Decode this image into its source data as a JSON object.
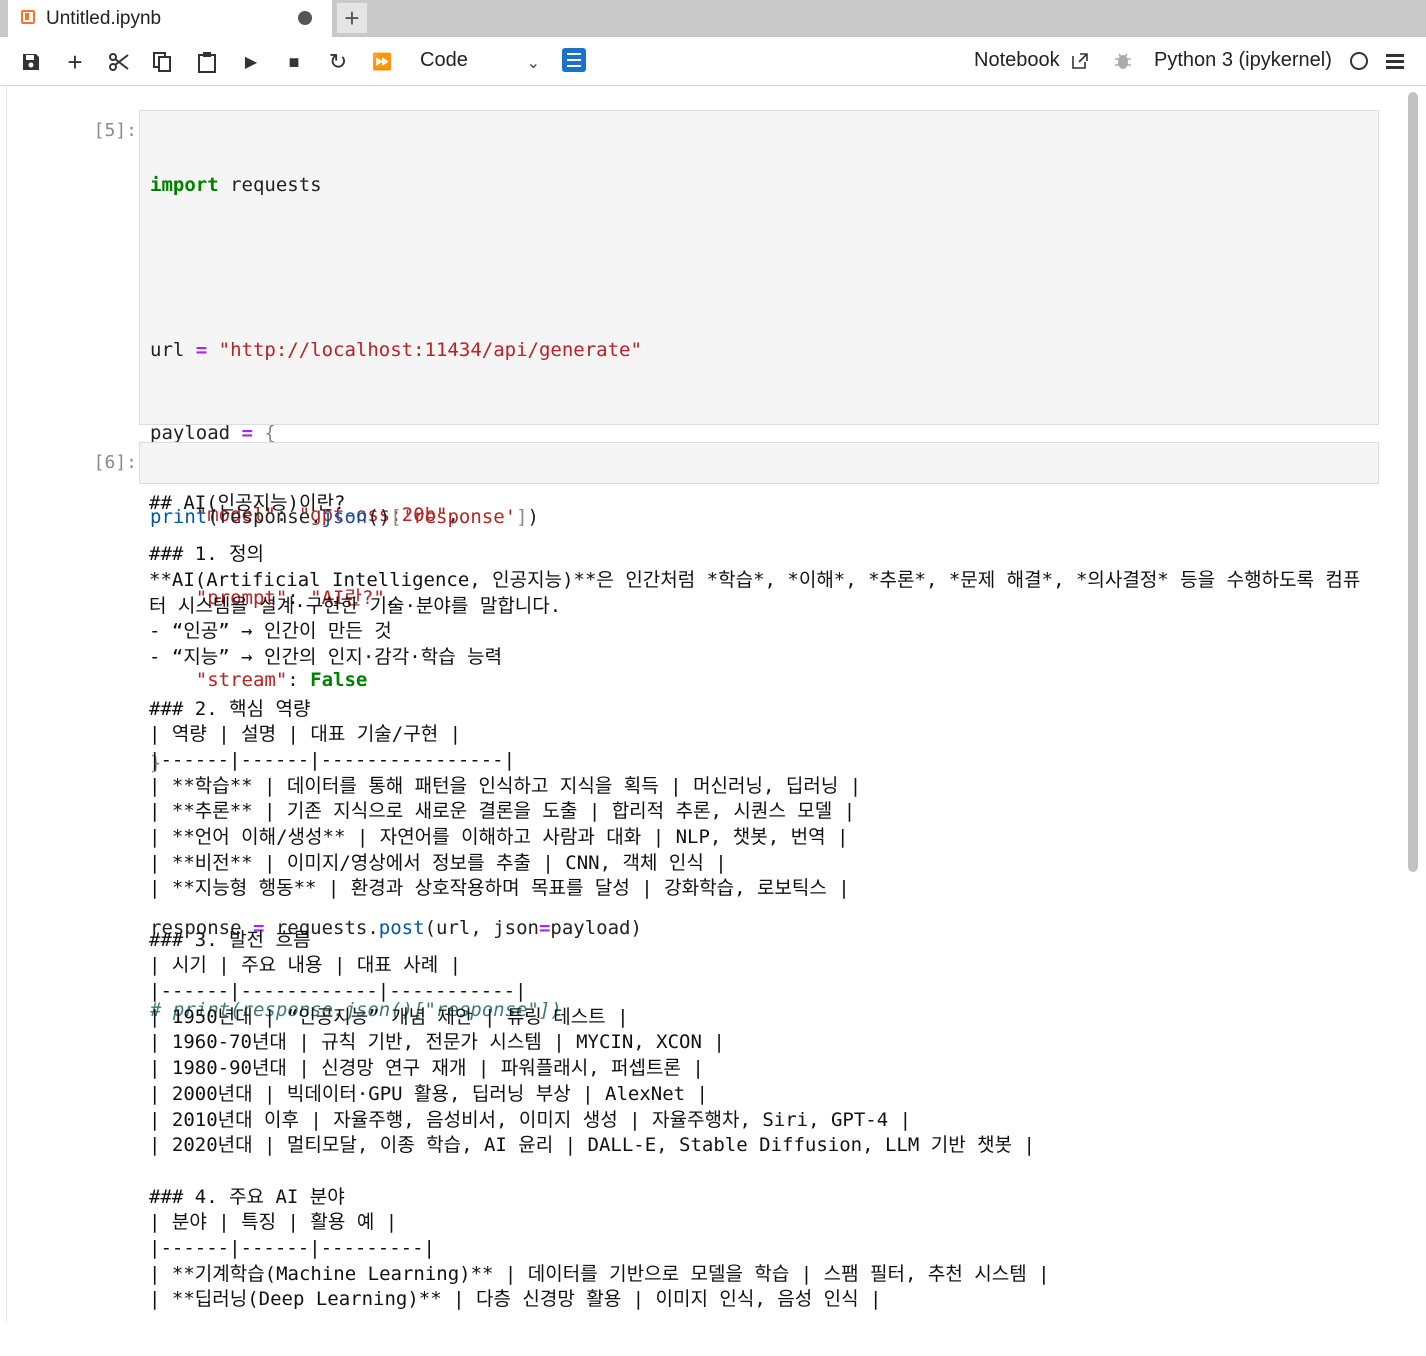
{
  "tab": {
    "title": "Untitled.ipynb",
    "new_tab": "+"
  },
  "toolbar": {
    "save": "save-icon",
    "add": "+",
    "cut": "cut-icon",
    "copy": "copy-icon",
    "paste": "paste-icon",
    "run": "▶",
    "stop": "■",
    "restart": "↻",
    "run_all": "⏩",
    "cell_type": "Code",
    "notebook_link": "Notebook",
    "kernel": "Python 3 (ipykernel)"
  },
  "cells": [
    {
      "prompt": "[5]:",
      "code": {
        "l1_kw": "import",
        "l1_rest": " requests",
        "l3_a": "url ",
        "l3_op": "=",
        "l3_str": " \"http://localhost:11434/api/generate\"",
        "l4_a": "payload ",
        "l4_op": "=",
        "l4_br": " {",
        "l5_k": "    \"model\"",
        "l5_sep": ": ",
        "l5_v": "\"gpt-oss:20b\"",
        "l5_end": ",",
        "l6_k": "    \"prompt\"",
        "l6_sep": ": ",
        "l6_v": "\"AI란?\"",
        "l6_end": ",",
        "l7_k": "    \"stream\"",
        "l7_sep": ": ",
        "l7_v": "False",
        "l8_br": "}",
        "l10_a": "response ",
        "l10_op": "=",
        "l10_b": " requests.",
        "l10_fn": "post",
        "l10_c": "(url, json",
        "l10_op2": "=",
        "l10_d": "payload)",
        "l11_cm": "# print(response.json()[\"response\"])"
      }
    },
    {
      "prompt": "[6]:",
      "code": {
        "fn1": "print",
        "a": "(response.",
        "fn2": "json",
        "b": "()",
        "br1": "[",
        "str": "'response'",
        "br2": "]",
        "c": ")"
      }
    }
  ],
  "output_lines": [
    "## AI(인공지능)이란?",
    "",
    "### 1. 정의",
    "**AI(Artificial Intelligence, 인공지능)**은 인간처럼 *학습*, *이해*, *추론*, *문제 해결*, *의사결정* 등을 수행하도록 컴퓨",
    "터 시스템을 설계·구현한 기술·분야를 말합니다.",
    "- “인공” → 인간이 만든 것",
    "- “지능” → 인간의 인지·감각·학습 능력",
    "",
    "### 2. 핵심 역량",
    "| 역량 | 설명 | 대표 기술/구현 |",
    "|------|------|----------------|",
    "| **학습** | 데이터를 통해 패턴을 인식하고 지식을 획득 | 머신러닝, 딥러닝 |",
    "| **추론** | 기존 지식으로 새로운 결론을 도출 | 합리적 추론, 시퀀스 모델 |",
    "| **언어 이해/생성** | 자연어를 이해하고 사람과 대화 | NLP, 챗봇, 번역 |",
    "| **비전** | 이미지/영상에서 정보를 추출 | CNN, 객체 인식 |",
    "| **지능형 행동** | 환경과 상호작용하며 목표를 달성 | 강화학습, 로보틱스 |",
    "",
    "### 3. 발전 흐름",
    "| 시기 | 주요 내용 | 대표 사례 |",
    "|------|------------|-----------|",
    "| 1950년대 | “인공지능” 개념 제안 | 튜링 테스트 |",
    "| 1960-70년대 | 규칙 기반, 전문가 시스템 | MYCIN, XCON |",
    "| 1980-90년대 | 신경망 연구 재개 | 파워플래시, 퍼셉트론 |",
    "| 2000년대 | 빅데이터·GPU 활용, 딥러닝 부상 | AlexNet |",
    "| 2010년대 이후 | 자율주행, 음성비서, 이미지 생성 | 자율주행차, Siri, GPT-4 |",
    "| 2020년대 | 멀티모달, 이종 학습, AI 윤리 | DALL-E, Stable Diffusion, LLM 기반 챗봇 |",
    "",
    "### 4. 주요 AI 분야",
    "| 분야 | 특징 | 활용 예 |",
    "|------|------|---------|",
    "| **기계학습(Machine Learning)** | 데이터를 기반으로 모델을 학습 | 스팸 필터, 추천 시스템 |",
    "| **딥러닝(Deep Learning)** | 다층 신경망 활용 | 이미지 인식, 음성 인식 |"
  ]
}
